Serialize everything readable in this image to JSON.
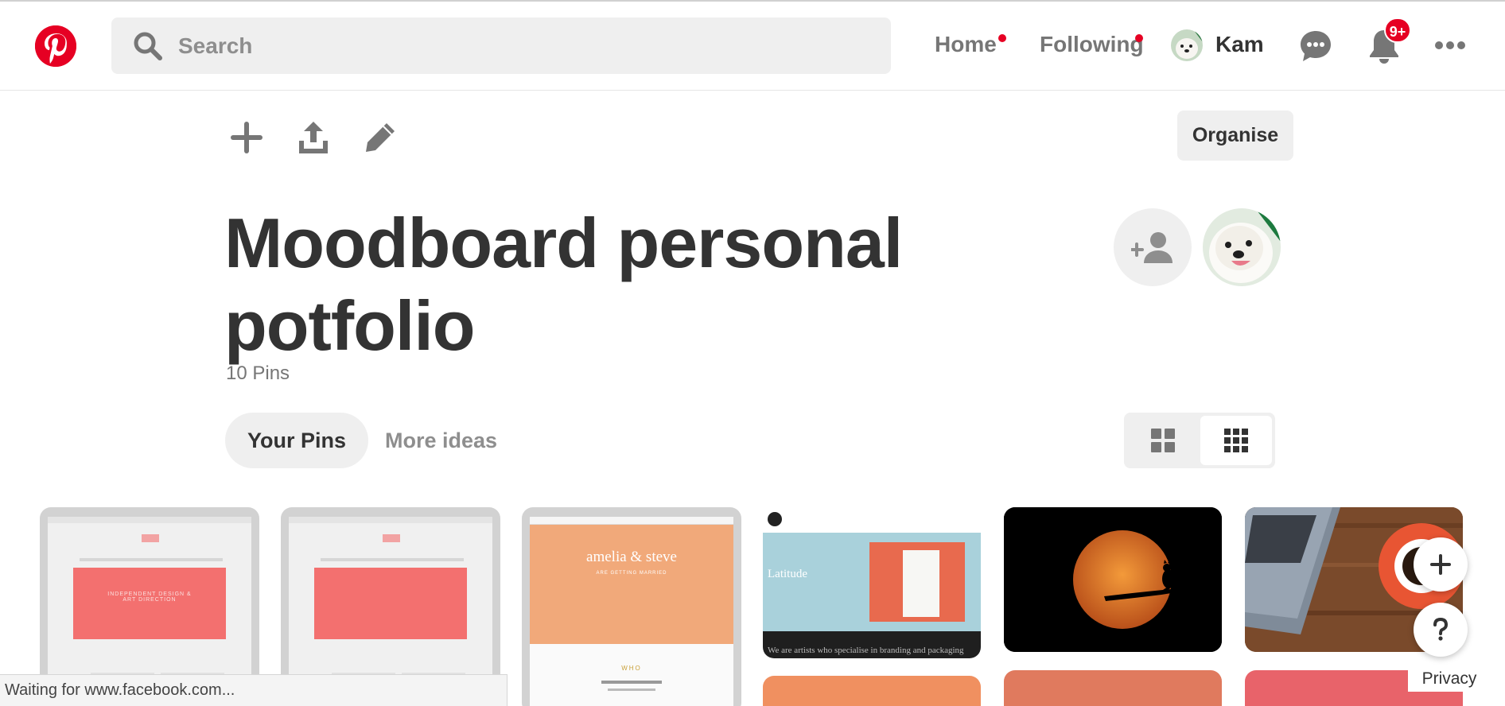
{
  "header": {
    "search_placeholder": "Search",
    "nav_home": "Home",
    "nav_following": "Following",
    "user_name": "Kam",
    "notifications_badge": "9+"
  },
  "toolbar": {
    "organise_label": "Organise"
  },
  "board": {
    "title": "Moodboard personal potfolio",
    "pin_count": "10 Pins"
  },
  "tabs": {
    "your_pins": "Your Pins",
    "more_ideas": "More ideas"
  },
  "pins": {
    "pin1_heading": "INDEPENDENT DESIGN &",
    "pin1_heading2": "ART DIRECTION",
    "pin3_heading": "amelia & steve",
    "pin3_sub": "ARE GETTING MARRIED",
    "pin3_section": "WHO",
    "pin4_heading": "Latitude",
    "pin4_caption": "We are artists who specialise in branding and packaging"
  },
  "floating": {
    "privacy_label": "Privacy"
  },
  "statusbar": {
    "text": "Waiting for www.facebook.com..."
  },
  "colors": {
    "brand": "#e60023",
    "mock_pink": "#f3706f",
    "mock_peach": "#f1a97a",
    "mock_blue": "#a9d1db"
  }
}
